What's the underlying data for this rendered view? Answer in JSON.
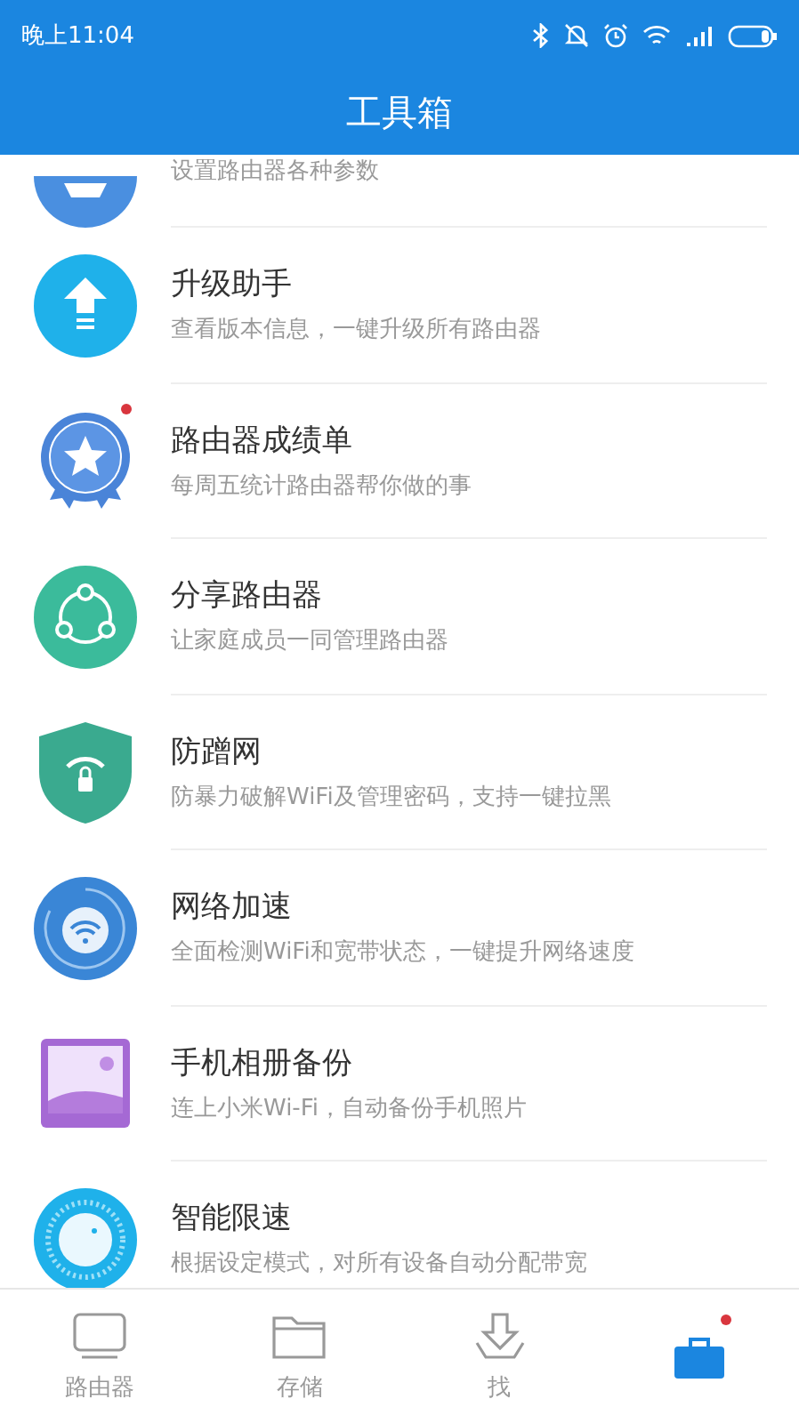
{
  "status_bar": {
    "time": "晚上11:04"
  },
  "header": {
    "title": "工具箱"
  },
  "tools": [
    {
      "kind": "settings",
      "subtitle": "设置路由器各种参数",
      "badge": false,
      "partial": true
    },
    {
      "kind": "upgrade",
      "title": "升级助手",
      "subtitle": "查看版本信息，一键升级所有路由器",
      "badge": false
    },
    {
      "kind": "medal",
      "title": "路由器成绩单",
      "subtitle": "每周五统计路由器帮你做的事",
      "badge": true
    },
    {
      "kind": "share",
      "title": "分享路由器",
      "subtitle": "让家庭成员一同管理路由器",
      "badge": false
    },
    {
      "kind": "shield",
      "title": "防蹭网",
      "subtitle": "防暴力破解WiFi及管理密码，支持一键拉黑",
      "badge": false
    },
    {
      "kind": "speed",
      "title": "网络加速",
      "subtitle": "全面检测WiFi和宽带状态，一键提升网络速度",
      "badge": false
    },
    {
      "kind": "photo",
      "title": "手机相册备份",
      "subtitle": "连上小米Wi-Fi，自动备份手机照片",
      "badge": false
    },
    {
      "kind": "limit",
      "title": "智能限速",
      "subtitle": "根据设定模式，对所有设备自动分配带宽",
      "badge": false
    }
  ],
  "tabs": [
    {
      "kind": "router",
      "label": "路由器",
      "selected": false,
      "badge": false
    },
    {
      "kind": "storage",
      "label": "存储",
      "selected": false,
      "badge": false
    },
    {
      "kind": "download",
      "label": "找",
      "selected": false,
      "badge": false
    },
    {
      "kind": "toolbox",
      "selected": true,
      "badge": true
    }
  ]
}
